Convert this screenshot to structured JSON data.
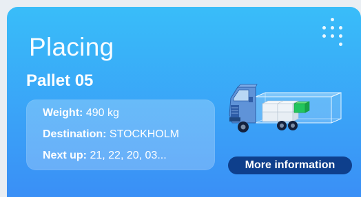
{
  "card": {
    "title": "Placing",
    "pallet_label": "Pallet 05",
    "info": {
      "weight_label": "Weight:",
      "weight_value": "490 kg",
      "destination_label": "Destination:",
      "destination_value": "STOCKHOLM",
      "next_up_label": "Next up:",
      "next_up_value": "21, 22, 20, 03..."
    },
    "button_label": "More information"
  },
  "icons": {
    "menu": "dots-grid-icon",
    "illustration": "truck-cargo-illustration"
  },
  "colors": {
    "card_gradient_top": "#39bdf9",
    "card_gradient_bottom": "#3a8ff6",
    "button_bg": "#0e3f8c",
    "active_pallet": "#22c55e",
    "text": "#ffffff"
  }
}
